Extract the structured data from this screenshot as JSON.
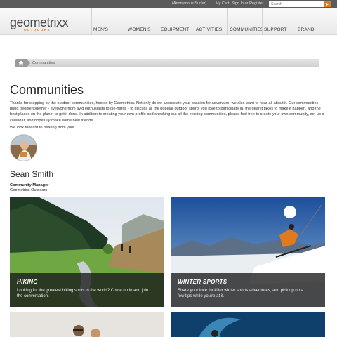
{
  "topbar": {
    "user": "(Anonymous Surfer)",
    "cart": "My Cart",
    "signin": "Sign In or Register",
    "search_placeholder": "Search"
  },
  "brand": {
    "logo": "geometrixx",
    "tagline": "OUTDOORS",
    "accent_color": "#e07a1f"
  },
  "nav": [
    "MEN'S",
    "WOMEN'S",
    "EQUIPMENT",
    "ACTIVITIES",
    "COMMUNITIES",
    "SUPPORT",
    "BRAND"
  ],
  "breadcrumb": {
    "home_icon": "home-icon",
    "current": "Communities"
  },
  "page": {
    "title": "Communities",
    "intro": "Thanks for stopping by the outdoor communities, hosted by Geometrixx. Not only do we appreciate your passion for adventure, we also want to hear all about it. Our communities bring people together - everyone from avid enthusiasts to die-hards - to discuss all the popular outdoor sports you love to participate in, the gear it takes to make it happen, and the best places on the planet to get it done. In addition to creating your own profile and checking out all the existing communities, please feel free to create your own community, set up a calendar, and hopefully make some new friends.",
    "closing": "We look forward to hearing from you!"
  },
  "manager": {
    "name": "Sean Smith",
    "role": "Community Manager",
    "company": "Geometrixx Outdoors"
  },
  "tiles": [
    {
      "title": "HIKING",
      "desc": "Looking for the greatest hiking spots in the world? Come on in and join the conversation."
    },
    {
      "title": "WINTER SPORTS",
      "desc": "Share your love for killer winter sports adventures, and pick up on a few tips while you're at it."
    }
  ]
}
